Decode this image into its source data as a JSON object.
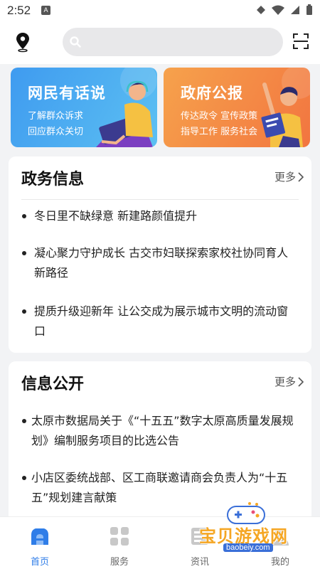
{
  "status_bar": {
    "time": "2:52",
    "notification": "A"
  },
  "search": {
    "placeholder": ""
  },
  "banners": [
    {
      "title": "网民有话说",
      "line1": "了解群众诉求",
      "line2": "回应群众关切",
      "color": "#4aa8f0"
    },
    {
      "title": "政府公报",
      "line1": "传达政令  宣传政策",
      "line2": "指导工作  服务社会",
      "color": "#f58b45"
    }
  ],
  "gov_info": {
    "title": "政务信息",
    "more": "更多",
    "items": [
      "冬日里不缺绿意 新建路颜值提升",
      "凝心聚力守护成长 古交市妇联探索家校社协同育人新路径",
      "提质升级迎新年 让公交成为展示城市文明的流动窗口"
    ]
  },
  "public_info": {
    "title": "信息公开",
    "more": "更多",
    "items": [
      "太原市数据局关于《“十五五”数字太原高质量发展规划》编制服务项目的比选公告",
      "小店区委统战部、区工商联邀请商会负责人为“十五五”规划建言献策"
    ]
  },
  "tabs": [
    {
      "label": "首页",
      "icon": "home-icon",
      "active": true
    },
    {
      "label": "服务",
      "icon": "grid-icon",
      "active": false
    },
    {
      "label": "资讯",
      "icon": "news-icon",
      "active": false
    },
    {
      "label": "我的",
      "icon": "profile-icon",
      "active": false
    }
  ],
  "watermark": {
    "text": "宝贝游戏网",
    "url": "baobeiy.com"
  },
  "colors": {
    "accent": "#2f7de8",
    "background": "#f2f3f5"
  }
}
